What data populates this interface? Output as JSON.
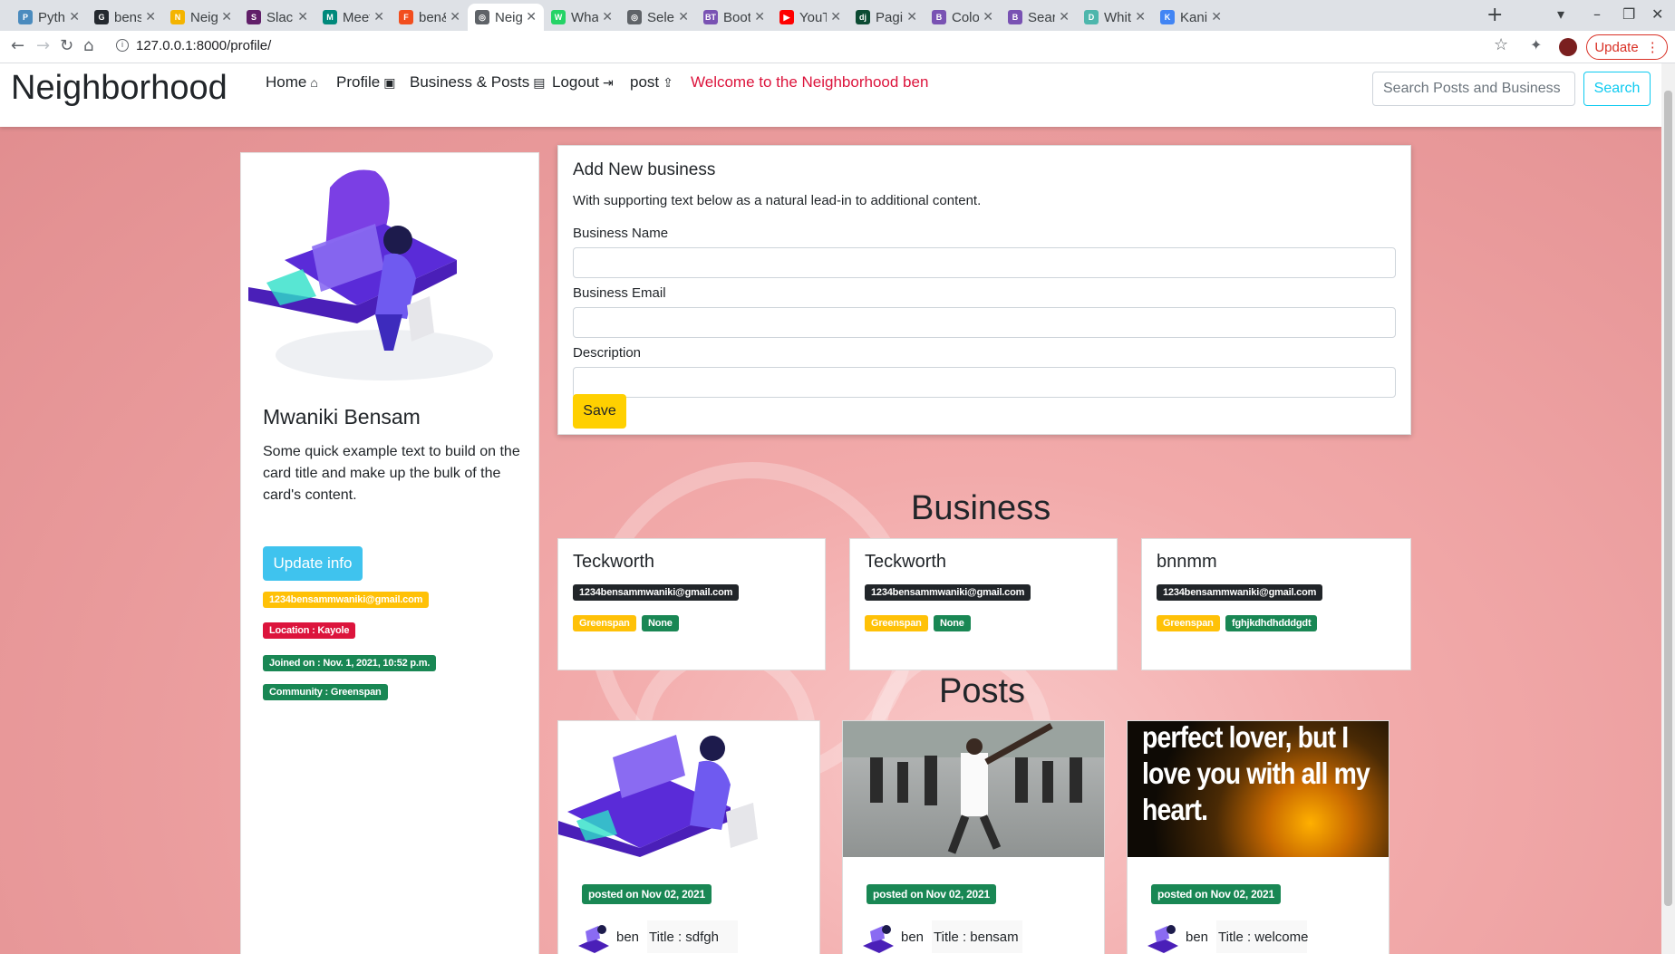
{
  "browser": {
    "tabs": [
      {
        "title": "Pytho",
        "color": "#4b8bbe",
        "glyph": "P"
      },
      {
        "title": "bens",
        "color": "#24292f",
        "glyph": "G"
      },
      {
        "title": "Neigh",
        "color": "#f4b400",
        "glyph": "N"
      },
      {
        "title": "Slack",
        "color": "#611f69",
        "glyph": "S"
      },
      {
        "title": "Meet",
        "color": "#00897b",
        "glyph": "M"
      },
      {
        "title": "ben&",
        "color": "#f24e1e",
        "glyph": "F"
      },
      {
        "title": "Neigh",
        "color": "#5f6368",
        "glyph": "◎"
      },
      {
        "title": "What",
        "color": "#25d366",
        "glyph": "W"
      },
      {
        "title": "Selec",
        "color": "#5f6368",
        "glyph": "◎"
      },
      {
        "title": "Boot",
        "color": "#7952b3",
        "glyph": "BT"
      },
      {
        "title": "YouT",
        "color": "#ff0000",
        "glyph": "▶"
      },
      {
        "title": "Pagin",
        "color": "#0c4b33",
        "glyph": "dj"
      },
      {
        "title": "Color",
        "color": "#7952b3",
        "glyph": "B"
      },
      {
        "title": "Searc",
        "color": "#7952b3",
        "glyph": "B"
      },
      {
        "title": "Whit",
        "color": "#4db6ac",
        "glyph": "D"
      },
      {
        "title": "Kanit",
        "color": "#4285f4",
        "glyph": "K"
      }
    ],
    "active_tab": 6,
    "url": "127.0.0.1:8000/profile/",
    "update_label": "Update"
  },
  "nav": {
    "brand": "Neighborhood",
    "links": [
      {
        "label": "Home",
        "icon": "⌂"
      },
      {
        "label": "Profile",
        "icon": "▣"
      },
      {
        "label": "Business & Posts",
        "icon": "▤"
      },
      {
        "label": "Logout",
        "icon": "⇥"
      },
      {
        "label": "post",
        "icon": "⇪"
      }
    ],
    "welcome": "Welcome to the Neighborhood ben",
    "search_placeholder": "Search Posts and Business",
    "search_label": "Search"
  },
  "profile": {
    "name": "Mwaniki Bensam",
    "text": "Some quick example text to build on the card title and make up the bulk of the card's content.",
    "update_label": "Update info",
    "email": "1234bensammwaniki@gmail.com",
    "location": "Location : Kayole",
    "joined": "Joined on : Nov. 1, 2021, 10:52 p.m.",
    "community": "Community : Greenspan"
  },
  "form": {
    "title": "Add New business",
    "subtitle": "With supporting text below as a natural lead-in to additional content.",
    "name_label": "Business Name",
    "email_label": "Business Email",
    "desc_label": "Description",
    "save_label": "Save"
  },
  "business_heading": "Business",
  "businesses": [
    {
      "name": "Teckworth",
      "email": "1234bensammwaniki@gmail.com",
      "community": "Greenspan",
      "tag": "None"
    },
    {
      "name": "Teckworth",
      "email": "1234bensammwaniki@gmail.com",
      "community": "Greenspan",
      "tag": "None"
    },
    {
      "name": "bnnmm",
      "email": "1234bensammwaniki@gmail.com",
      "community": "Greenspan",
      "tag": "fghjkdhdhdddgdt"
    }
  ],
  "posts_heading": "Posts",
  "posts": [
    {
      "date": "posted on Nov 02, 2021",
      "user": "ben",
      "title": "Title : sdfgh"
    },
    {
      "date": "posted on Nov 02, 2021",
      "user": "ben",
      "title": "Title : bensam"
    },
    {
      "date": "posted on Nov 02, 2021",
      "user": "ben",
      "title": "Title : welcome"
    }
  ],
  "post3_image_text": "perfect lover, but I love you with all my heart."
}
